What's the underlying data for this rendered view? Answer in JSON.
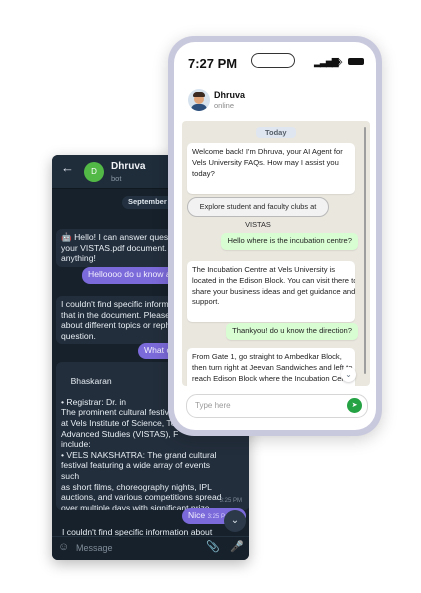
{
  "telegram": {
    "header": {
      "back_icon": "arrow-left-icon",
      "avatar_letter": "D",
      "name": "Dhruva",
      "status": "bot"
    },
    "date": "September 2",
    "messages": [
      {
        "side": "in",
        "text": "🤖 Hello! I can answer questio\nyour VISTAS.pdf document. Ju\nanything!"
      },
      {
        "side": "out",
        "text": "Helloooo do u know an"
      },
      {
        "side": "in",
        "text": "I couldn't find specific informa\nthat in the document. Please t\nabout different topics or reph\nquestion."
      },
      {
        "side": "out",
        "text": "What c"
      },
      {
        "side": "in",
        "text": "Bhaskaran\n\n• Registrar: Dr. in\nThe prominent cultural festiva\nat Vels Institute of Science, Te\nAdvanced Studies (VISTAS), F\ninclude:\n• VELS NAKSHATRA: The grand cultural\nfestival featuring a wide array of events\nsuch\nas short films, choreography nights, IPL\nauctions, and various competitions spread\nover multiple days with significant prize\nmoney.",
        "time": "3:25 PM"
      },
      {
        "side": "out",
        "text": "Nice",
        "time": "3:25 P"
      },
      {
        "side": "in",
        "text": "I couldn't find specific information about"
      }
    ],
    "scroll_down_icon": "chevron-down-icon",
    "input": {
      "placeholder": "Message",
      "emoji_icon": "smiley-icon",
      "attach_icon": "paperclip-icon",
      "mic_icon": "microphone-icon"
    }
  },
  "whatsapp": {
    "status_bar": {
      "time": "7:27 PM"
    },
    "contact": {
      "name": "Dhruva",
      "status": "online"
    },
    "date": "Today",
    "messages": [
      {
        "side": "in",
        "text": "Welcome back! I'm Dhruva, your AI Agent for\nVels University FAQs. How may I assist you\ntoday?"
      },
      {
        "side": "chip",
        "text": "Explore student and faculty clubs at VISTAS"
      },
      {
        "side": "out",
        "text": "Hello where is the incubation centre?"
      },
      {
        "side": "in",
        "text": "The Incubation Centre at Vels University is\nlocated in the Edison Block. You can visit there to\nshare your business ideas and get guidance and\nsupport."
      },
      {
        "side": "out",
        "text": "Thankyou! do u know the direction?"
      },
      {
        "side": "in",
        "text": "From Gate 1, go straight to Ambedkar Block,\nthen turn right at Jeevan Sandwiches and left to\nreach Edison Block where the Incubation Cen"
      }
    ],
    "scroll_down_icon": "chevron-down-icon",
    "input": {
      "placeholder": "Type here",
      "send_icon": "send-icon"
    }
  }
}
